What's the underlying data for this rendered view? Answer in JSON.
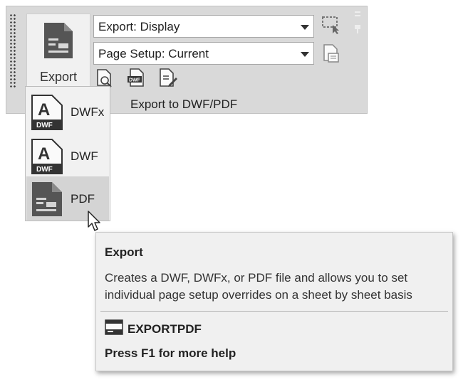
{
  "ribbon": {
    "export_button_label": "Export",
    "export_combo_value": "Export: Display",
    "page_setup_combo_value": "Page Setup: Current",
    "group_label": "Export to DWF/PDF",
    "small_icons": [
      "preview-icon",
      "dwf-publish-icon",
      "page-setup-edit-icon"
    ],
    "side_icons": [
      "window-select-icon",
      "page-setup-list-icon"
    ]
  },
  "menu": {
    "items": [
      {
        "label": "DWFx",
        "badge": "DWF",
        "letter": "A",
        "icon": "dwfx-file-icon"
      },
      {
        "label": "DWF",
        "badge": "DWF",
        "letter": "A",
        "icon": "dwf-file-icon"
      },
      {
        "label": "PDF",
        "icon": "pdf-file-icon",
        "highlighted": true
      }
    ]
  },
  "tooltip": {
    "title": "Export",
    "description": "Creates a DWF, DWFx, or PDF file and allows you to set individual page setup overrides on a sheet by sheet basis",
    "command": "EXPORTPDF",
    "help": "Press F1 for more help"
  },
  "colors": {
    "panel_bg": "#d9d9d9",
    "menu_bg": "#f1f1f1",
    "highlight": "#d4d4d4",
    "icon_dark": "#555555",
    "tooltip_bg": "#f0f0f0"
  }
}
